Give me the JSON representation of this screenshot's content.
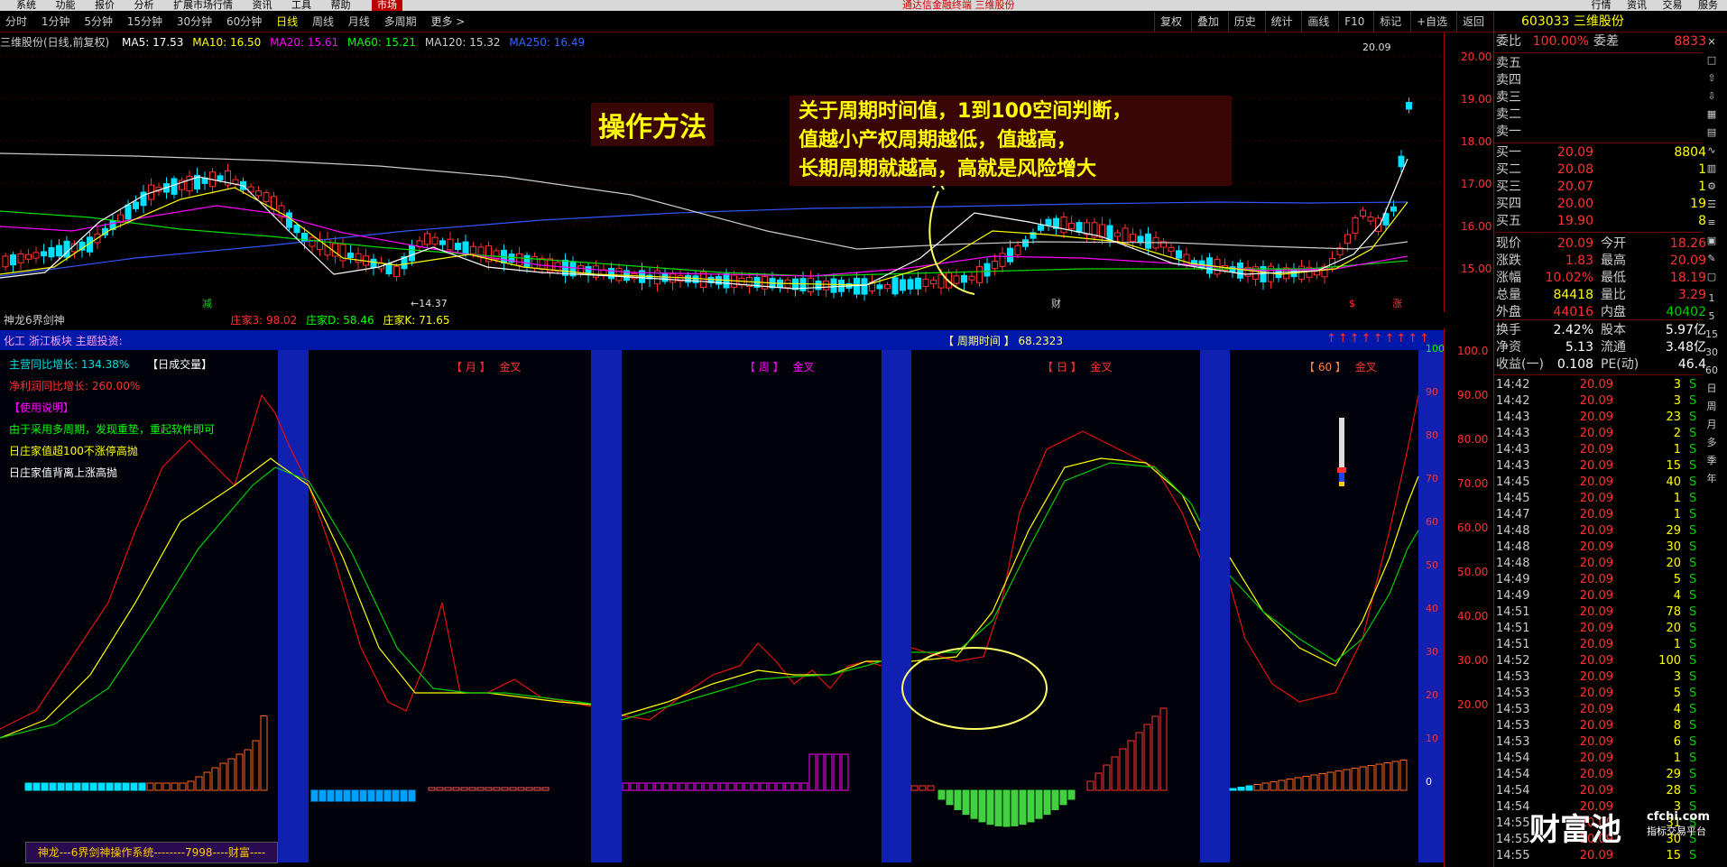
{
  "menubar": {
    "items": [
      "系统",
      "功能",
      "报价",
      "分析",
      "扩展市场行情",
      "资讯",
      "工具",
      "帮助"
    ],
    "market_tab": "市场",
    "window_title": "通达信金融终端  三维股份",
    "right_items": [
      "行情",
      "资讯",
      "交易",
      "服务"
    ]
  },
  "toolbar": {
    "periods": [
      "分时",
      "1分钟",
      "5分钟",
      "15分钟",
      "30分钟",
      "60分钟",
      "日线",
      "周线",
      "月线",
      "多周期",
      "更多 >"
    ],
    "active": "日线",
    "right_buttons": [
      "复权",
      "叠加",
      "历史",
      "统计",
      "画线",
      "F10",
      "标记",
      "+自选",
      "返回"
    ]
  },
  "ma_legend": {
    "stock": "三维股份(日线,前复权)",
    "items": [
      {
        "label": "MA5: 17.53",
        "color": "#ffffff"
      },
      {
        "label": "MA10: 16.50",
        "color": "#ffff00"
      },
      {
        "label": "MA20: 15.61",
        "color": "#ff00ff"
      },
      {
        "label": "MA60: 15.21",
        "color": "#00ff00"
      },
      {
        "label": "MA120: 15.32",
        "color": "#cccccc"
      },
      {
        "label": "MA250: 16.49",
        "color": "#3366ff"
      }
    ]
  },
  "price_axis": [
    "20.00",
    "19.00",
    "18.00",
    "17.00",
    "16.00",
    "15.00"
  ],
  "chart_labels": {
    "high": "20.09",
    "low": "←14.37",
    "mark_left": "减",
    "mark_mid": "财",
    "mark_right1": "$",
    "mark_right2": "涨"
  },
  "annotations": {
    "method": "操作方法",
    "note_line1": "关于周期时间值，1到100空间判断，",
    "note_line2": "值越小产权周期越低，值越高，",
    "note_line3": "长期周期就越高，高就是风险增大"
  },
  "sub_header": {
    "name": "神龙6界剑神",
    "items": [
      {
        "label": "庄家3: 98.02",
        "color": "#ff3030"
      },
      {
        "label": "庄家D: 58.46",
        "color": "#00ff00"
      },
      {
        "label": "庄家K: 71.65",
        "color": "#ffff00"
      }
    ]
  },
  "blueband": {
    "left": "化工 浙江板块 主题投资:",
    "cycle": "【 周期时间 】 68.2323",
    "arrows": "↑↑↑↑↑↑↑↑↑"
  },
  "indicator_text": {
    "line1": "主营同比增长: 134.38%",
    "line1_title": "【日成交量】",
    "line2": "净利润同比增长: 260.00%",
    "line3": "【使用说明】",
    "line4": "由于采用多周期，发现重垫，重起软件即可",
    "line5": "日庄家值超100不涨停高抛",
    "line6": "日庄家值背离上涨高抛",
    "footer": "神龙---6界剑神操作系统--------7998----财富----"
  },
  "section_titles": [
    {
      "tag": "【 月 】",
      "cross": "金叉"
    },
    {
      "tag": "【 周 】",
      "cross": "金叉"
    },
    {
      "tag": "【 日 】",
      "cross": "金叉"
    },
    {
      "tag": "【 60 】",
      "cross": "金叉"
    }
  ],
  "sub_axis_left": [
    "100",
    "90",
    "80",
    "70",
    "60",
    "50",
    "40",
    "30",
    "20",
    "10",
    "0"
  ],
  "sub_axis_right": [
    "100.0",
    "90.00",
    "80.00",
    "70.00",
    "60.00",
    "50.00",
    "40.00",
    "30.00",
    "20.00"
  ],
  "quote": {
    "code_name": "603033 三维股份",
    "weibi": {
      "label": "委比",
      "value": "100.00%",
      "label2": "委差",
      "value2": "8833"
    },
    "sells": [
      "卖五",
      "卖四",
      "卖三",
      "卖二",
      "卖一"
    ],
    "buys": [
      {
        "label": "买一",
        "price": "20.09",
        "vol": "8804"
      },
      {
        "label": "买二",
        "price": "20.08",
        "vol": "1"
      },
      {
        "label": "买三",
        "price": "20.07",
        "vol": "1"
      },
      {
        "label": "买四",
        "price": "20.00",
        "vol": "19"
      },
      {
        "label": "买五",
        "price": "19.90",
        "vol": "8"
      }
    ],
    "stats": [
      {
        "a": "现价",
        "b": "20.09",
        "c": "今开",
        "d": "18.26",
        "bc": "#ff3030",
        "dc": "#ff3030"
      },
      {
        "a": "涨跌",
        "b": "1.83",
        "c": "最高",
        "d": "20.09",
        "bc": "#ff3030",
        "dc": "#ff3030"
      },
      {
        "a": "涨幅",
        "b": "10.02%",
        "c": "最低",
        "d": "18.19",
        "bc": "#ff3030",
        "dc": "#ff3030"
      },
      {
        "a": "总量",
        "b": "84418",
        "c": "量比",
        "d": "3.29",
        "bc": "#ffff00",
        "dc": "#ff3030"
      },
      {
        "a": "外盘",
        "b": "44016",
        "c": "内盘",
        "d": "40402",
        "bc": "#ff3030",
        "dc": "#00cc00"
      }
    ],
    "stats2": [
      {
        "a": "换手",
        "b": "2.42%",
        "c": "股本",
        "d": "5.97亿"
      },
      {
        "a": "净资",
        "b": "5.13",
        "c": "流通",
        "d": "3.48亿"
      },
      {
        "a": "收益(一)",
        "b": "0.108",
        "c": "PE(动)",
        "d": "46.4"
      }
    ],
    "ticks": [
      {
        "t": "14:42",
        "p": "20.09",
        "v": "3"
      },
      {
        "t": "14:42",
        "p": "20.09",
        "v": "3"
      },
      {
        "t": "14:43",
        "p": "20.09",
        "v": "23"
      },
      {
        "t": "14:43",
        "p": "20.09",
        "v": "2"
      },
      {
        "t": "14:43",
        "p": "20.09",
        "v": "1"
      },
      {
        "t": "14:43",
        "p": "20.09",
        "v": "15"
      },
      {
        "t": "14:45",
        "p": "20.09",
        "v": "40"
      },
      {
        "t": "14:45",
        "p": "20.09",
        "v": "1"
      },
      {
        "t": "14:47",
        "p": "20.09",
        "v": "1"
      },
      {
        "t": "14:48",
        "p": "20.09",
        "v": "29"
      },
      {
        "t": "14:48",
        "p": "20.09",
        "v": "30"
      },
      {
        "t": "14:48",
        "p": "20.09",
        "v": "20"
      },
      {
        "t": "14:49",
        "p": "20.09",
        "v": "5"
      },
      {
        "t": "14:49",
        "p": "20.09",
        "v": "4"
      },
      {
        "t": "14:51",
        "p": "20.09",
        "v": "78"
      },
      {
        "t": "14:51",
        "p": "20.09",
        "v": "20"
      },
      {
        "t": "14:51",
        "p": "20.09",
        "v": "1"
      },
      {
        "t": "14:52",
        "p": "20.09",
        "v": "100"
      },
      {
        "t": "14:53",
        "p": "20.09",
        "v": "3"
      },
      {
        "t": "14:53",
        "p": "20.09",
        "v": "5"
      },
      {
        "t": "14:53",
        "p": "20.09",
        "v": "4"
      },
      {
        "t": "14:53",
        "p": "20.09",
        "v": "8"
      },
      {
        "t": "14:53",
        "p": "20.09",
        "v": "6"
      },
      {
        "t": "14:54",
        "p": "20.09",
        "v": "1"
      },
      {
        "t": "14:54",
        "p": "20.09",
        "v": "29"
      },
      {
        "t": "14:54",
        "p": "20.09",
        "v": "28"
      },
      {
        "t": "14:54",
        "p": "20.09",
        "v": "3"
      },
      {
        "t": "14:55",
        "p": "20.09",
        "v": "31"
      },
      {
        "t": "14:55",
        "p": "20.09",
        "v": "30"
      },
      {
        "t": "14:55",
        "p": "20.09",
        "v": "15"
      }
    ],
    "tick_side": "S"
  },
  "side_icons": [
    "1",
    "5",
    "15",
    "30",
    "60",
    "日",
    "周",
    "月",
    "多",
    "季",
    "年"
  ],
  "watermark": {
    "brand": "财富池",
    "site": "cfchi.com",
    "tag": "指标交易平台"
  }
}
